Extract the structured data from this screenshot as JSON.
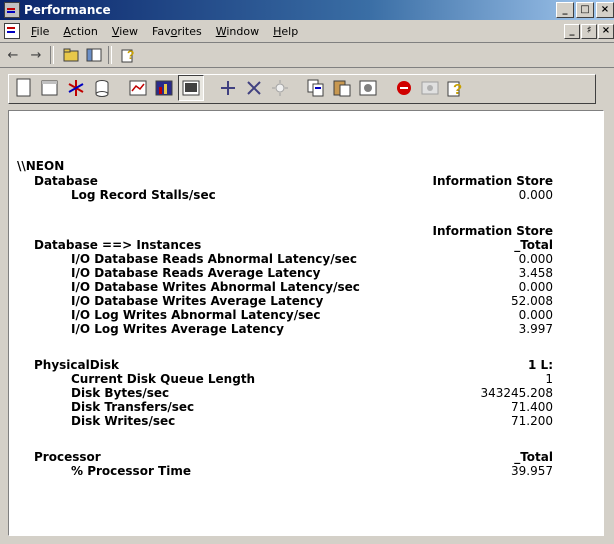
{
  "window": {
    "title": "Performance"
  },
  "menu": [
    "File",
    "Action",
    "View",
    "Favorites",
    "Window",
    "Help"
  ],
  "menu_underline": [
    "F",
    "A",
    "V",
    "o",
    "W",
    "H"
  ],
  "window_controls": [
    "_",
    "□",
    "×"
  ],
  "mdi_controls": [
    "_",
    "♯",
    "×"
  ],
  "report": {
    "machine": "\\\\NEON",
    "sections": [
      {
        "object": "Database",
        "instance_header": [
          "Information Store"
        ],
        "counters": [
          {
            "name": "Log Record Stalls/sec",
            "value": "0.000"
          }
        ]
      },
      {
        "object": "Database ==> Instances",
        "instance_header": [
          "Information Store",
          "_Total"
        ],
        "counters": [
          {
            "name": "I/O Database Reads Abnormal Latency/sec",
            "value": "0.000"
          },
          {
            "name": "I/O Database Reads Average Latency",
            "value": "3.458"
          },
          {
            "name": "I/O Database Writes Abnormal Latency/sec",
            "value": "0.000"
          },
          {
            "name": "I/O Database Writes Average Latency",
            "value": "52.008"
          },
          {
            "name": "I/O Log Writes Abnormal Latency/sec",
            "value": "0.000"
          },
          {
            "name": "I/O Log Writes Average Latency",
            "value": "3.997"
          }
        ]
      },
      {
        "object": "PhysicalDisk",
        "instance_header": [
          "1 L:"
        ],
        "counters": [
          {
            "name": "Current Disk Queue Length",
            "value": "1"
          },
          {
            "name": "Disk Bytes/sec",
            "value": "343245.208"
          },
          {
            "name": "Disk Transfers/sec",
            "value": "71.400"
          },
          {
            "name": "Disk Writes/sec",
            "value": "71.200"
          }
        ]
      },
      {
        "object": "Processor",
        "instance_header": [
          "_Total"
        ],
        "counters": [
          {
            "name": "% Processor Time",
            "value": "39.957"
          }
        ]
      }
    ]
  },
  "colors": {
    "titlebar": "#0a246a",
    "face": "#d4d0c8",
    "background": "#ffffff"
  }
}
